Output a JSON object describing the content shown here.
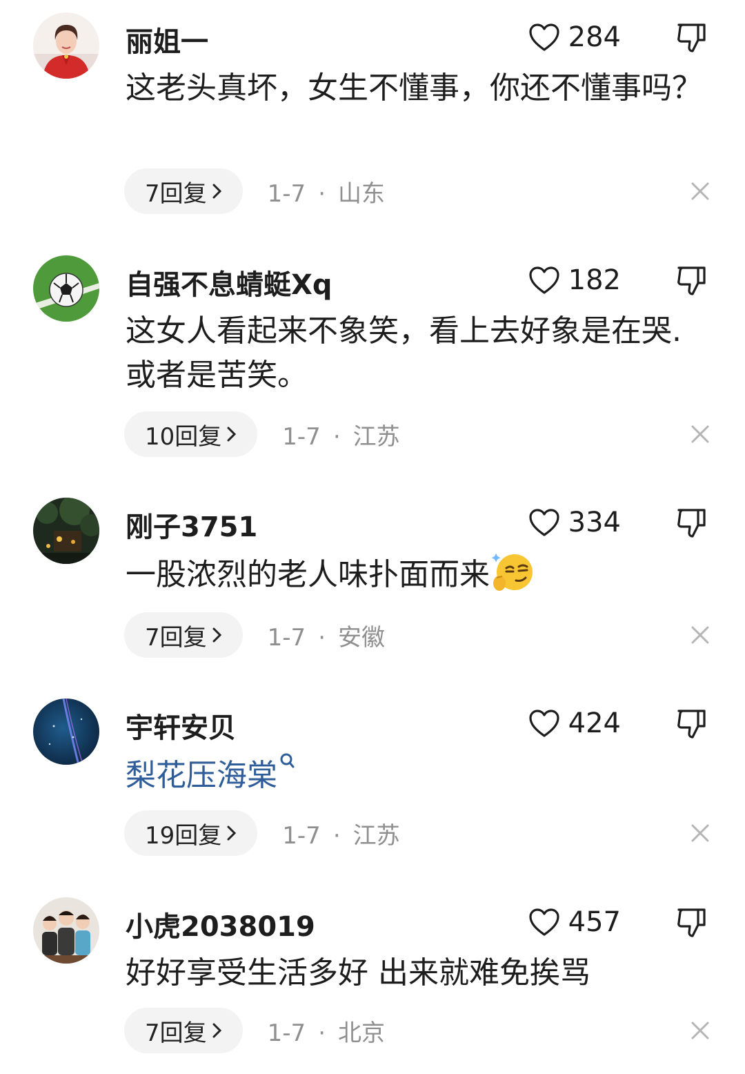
{
  "comments": [
    {
      "user": "丽姐一",
      "likes": "284",
      "text": "这老头真坏，女生不懂事，你还不懂事吗？",
      "replies": "7回复",
      "date": "1-7",
      "location": "山东",
      "avatar": "woman-portrait"
    },
    {
      "user": "自强不息蜻蜓Xq",
      "likes": "182",
      "text": "这女人看起来不象笑，看上去好象是在哭.或者是苦笑。",
      "replies": "10回复",
      "date": "1-7",
      "location": "江苏",
      "avatar": "soccer-ball"
    },
    {
      "user": "刚子3751",
      "likes": "334",
      "text": "一股浓烈的老人味扑面而来",
      "emoji": "smirk-emoji",
      "replies": "7回复",
      "date": "1-7",
      "location": "安徽",
      "avatar": "night-garden"
    },
    {
      "user": "宇轩安贝",
      "likes": "424",
      "text": "梨花压海棠",
      "text_is_search_link": true,
      "replies": "19回复",
      "date": "1-7",
      "location": "江苏",
      "avatar": "blue-night-sky"
    },
    {
      "user": "小虎2038019",
      "likes": "457",
      "text": "好好享受生活多好 出来就难免挨骂",
      "replies": "7回复",
      "date": "1-7",
      "location": "北京",
      "avatar": "three-children"
    }
  ],
  "icons": {
    "like": "heart-outline-icon",
    "dislike": "thumbs-down-icon",
    "close": "close-icon",
    "reply_arrow": "chevron-right-icon",
    "search": "search-icon"
  },
  "colors": {
    "text": "#1d1d1d",
    "meta": "#8f8f8f",
    "link": "#2f5d9a",
    "pill_bg": "#f3f3f3"
  }
}
